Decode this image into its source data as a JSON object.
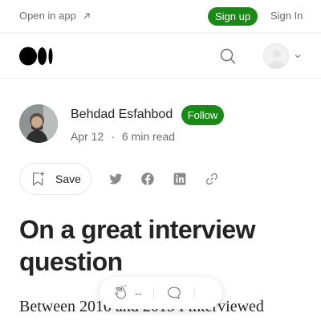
{
  "topbar": {
    "open_app": "Open in app",
    "signup": "Sign up",
    "signin": "Sign In"
  },
  "author": {
    "name": "Behdad Esfahbod",
    "follow": "Follow",
    "date": "Apr 12",
    "dot": "·",
    "read_time": "6 min read"
  },
  "actions": {
    "save": "Save"
  },
  "article": {
    "title": "On a great interview question",
    "body_preview": "Between 2010 and 2015 I interviewed"
  },
  "claps": {
    "count": "--"
  },
  "colors": {
    "brand_green": "#1a8917",
    "text": "#242424",
    "muted": "#6b6b6b"
  }
}
